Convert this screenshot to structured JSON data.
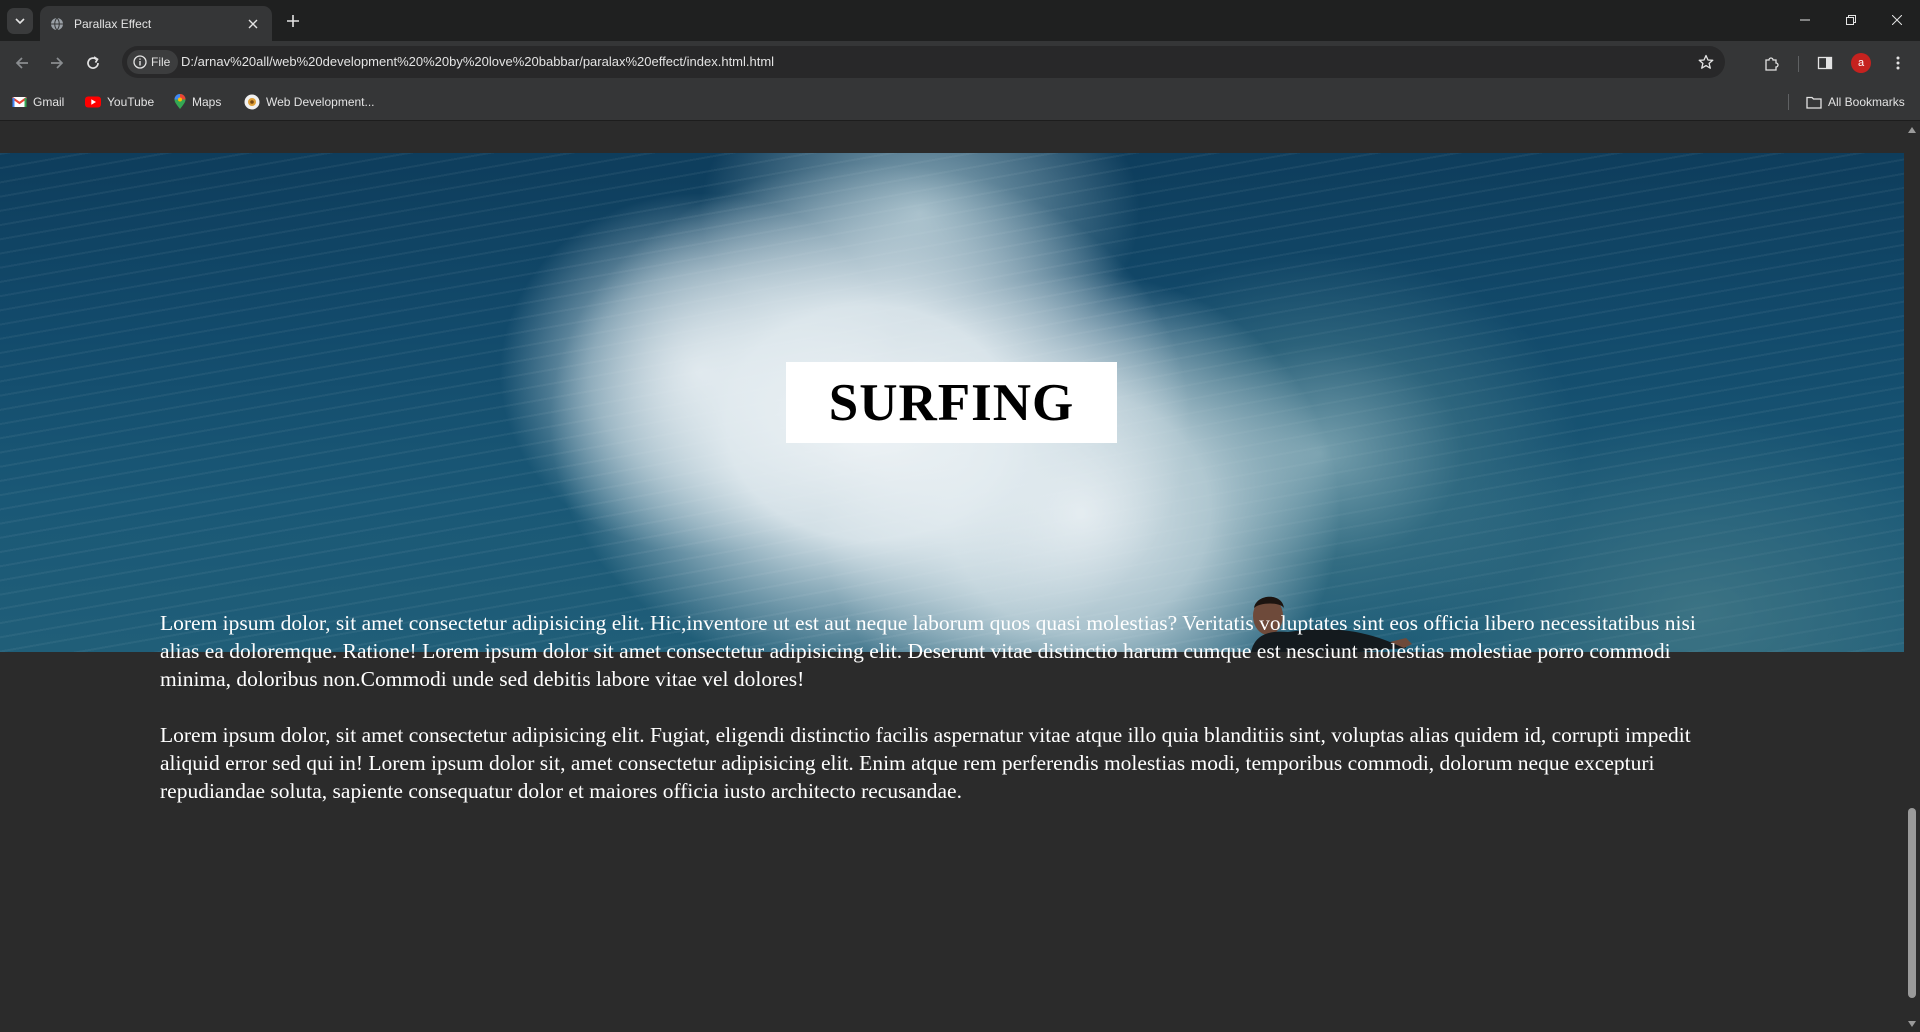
{
  "browser": {
    "tab_title": "Parallax Effect",
    "url": "D:/arnav%20all/web%20development%20%20by%20love%20babbar/paralax%20effect/index.html.html",
    "site_chip": "File",
    "avatar_letter": "a",
    "bookmarks": [
      {
        "label": "Gmail",
        "icon": "gmail-icon"
      },
      {
        "label": "YouTube",
        "icon": "youtube-icon"
      },
      {
        "label": "Maps",
        "icon": "maps-icon"
      },
      {
        "label": "Web Development...",
        "icon": "web-dev-icon"
      }
    ],
    "all_bookmarks": "All Bookmarks",
    "accent": "#c5221f"
  },
  "page": {
    "hero_title": "SURFING",
    "paragraphs": [
      "Lorem ipsum dolor, sit amet consectetur adipisicing elit. Hic,inventore ut est aut neque laborum quos quasi molestias? Veritatis voluptates sint eos officia libero necessitatibus nisi alias ea doloremque. Ratione! Lorem ipsum dolor sit amet consectetur adipisicing elit. Deserunt vitae distinctio harum cumque est nesciunt molestias molestiae porro commodi minima, doloribus non.Commodi unde sed debitis labore vitae vel dolores!",
      "Lorem ipsum dolor, sit amet consectetur adipisicing elit. Fugiat, eligendi distinctio facilis aspernatur vitae atque illo quia blanditiis sint, voluptas alias quidem id, corrupti impedit aliquid error sed qui in! Lorem ipsum dolor sit, amet consectetur adipisicing elit. Enim atque rem perferendis molestias modi, temporibus commodi, dolorum neque excepturi repudiandae soluta, sapiente consequatur dolor et maiores officia iusto architecto recusandae."
    ],
    "background_color": "#2b2b2b"
  }
}
